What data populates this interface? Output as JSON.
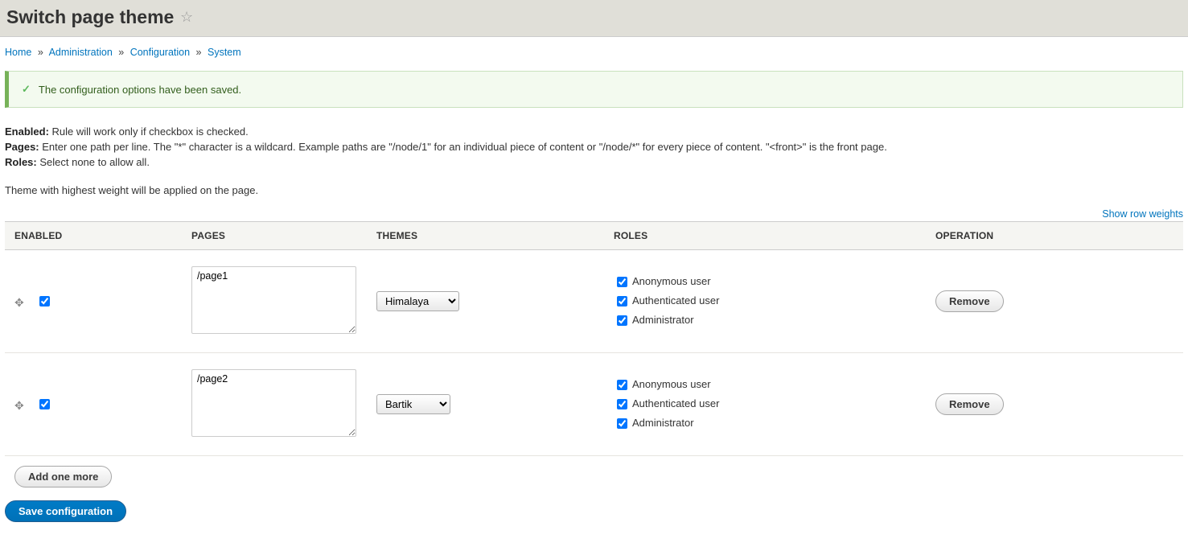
{
  "page_title": "Switch page theme",
  "breadcrumb": [
    {
      "label": "Home"
    },
    {
      "label": "Administration"
    },
    {
      "label": "Configuration"
    },
    {
      "label": "System"
    }
  ],
  "status_message": "The configuration options have been saved.",
  "help": {
    "enabled_label": "Enabled:",
    "enabled_text": " Rule will work only if checkbox is checked.",
    "pages_label": "Pages:",
    "pages_text": " Enter one path per line. The \"*\" character is a wildcard. Example paths are \"/node/1\" for an individual piece of content or \"/node/*\" for every piece of content. \"<front>\" is the front page.",
    "roles_label": "Roles:",
    "roles_text": " Select none to allow all."
  },
  "weight_note": "Theme with highest weight will be applied on the page.",
  "show_row_weights": "Show row weights",
  "columns": {
    "enabled": "Enabled",
    "pages": "Pages",
    "themes": "Themes",
    "roles": "Roles",
    "operation": "Operation"
  },
  "roles_options": [
    "Anonymous user",
    "Authenticated user",
    "Administrator"
  ],
  "rows": [
    {
      "enabled": true,
      "pages": "/page1",
      "theme": "Himalaya",
      "roles_checked": [
        true,
        true,
        true
      ],
      "remove_label": "Remove"
    },
    {
      "enabled": true,
      "pages": "/page2",
      "theme": "Bartik",
      "roles_checked": [
        true,
        true,
        true
      ],
      "remove_label": "Remove"
    }
  ],
  "add_button": "Add one more",
  "save_button": "Save configuration"
}
